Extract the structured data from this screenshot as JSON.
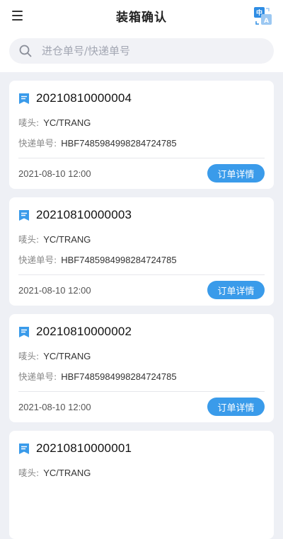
{
  "header": {
    "title": "装箱确认",
    "lang_icon_top": "中",
    "lang_icon_bottom": "A"
  },
  "search": {
    "placeholder": "进仓单号/快递单号"
  },
  "labels": {
    "mark": "唛头:",
    "express": "快递单号:",
    "detail_button": "订单详情"
  },
  "colors": {
    "accent": "#3a9bea",
    "background": "#eef0f5"
  },
  "orders": [
    {
      "order_no": "20210810000004",
      "mark": "YC/TRANG",
      "express_no": "HBF7485984998284724785",
      "date": "2021-08-10 12:00"
    },
    {
      "order_no": "20210810000003",
      "mark": "YC/TRANG",
      "express_no": "HBF7485984998284724785",
      "date": "2021-08-10 12:00"
    },
    {
      "order_no": "20210810000002",
      "mark": "YC/TRANG",
      "express_no": "HBF7485984998284724785",
      "date": "2021-08-10 12:00"
    },
    {
      "order_no": "20210810000001",
      "mark": "YC/TRANG",
      "express_no": "",
      "date": ""
    }
  ]
}
